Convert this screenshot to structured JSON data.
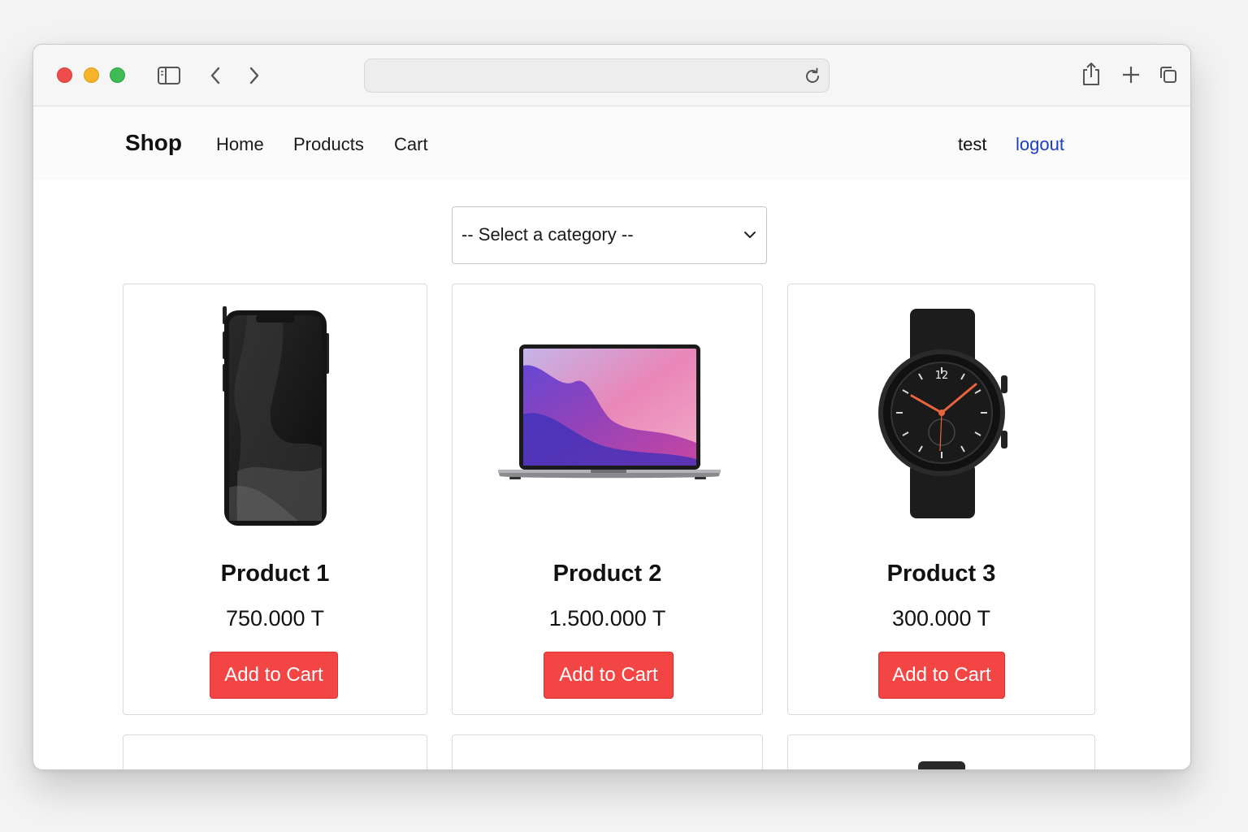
{
  "browser": {
    "url": "",
    "controls": [
      "sidebar-icon",
      "back-icon",
      "forward-icon",
      "reload-icon",
      "share-icon",
      "new-tab-icon",
      "tabs-overview-icon"
    ]
  },
  "navbar": {
    "brand": "Shop",
    "links": [
      {
        "label": "Home"
      },
      {
        "label": "Products"
      },
      {
        "label": "Cart"
      }
    ],
    "user": "test",
    "logout": "logout"
  },
  "filter": {
    "selected": "-- Select a category --"
  },
  "products": [
    {
      "name": "Product 1",
      "price": "750.000 T",
      "button": "Add to Cart",
      "image": "smartphone-image"
    },
    {
      "name": "Product 2",
      "price": "1.500.000 T",
      "button": "Add to Cart",
      "image": "laptop-image"
    },
    {
      "name": "Product 3",
      "price": "300.000 T",
      "button": "Add to Cart",
      "image": "smartwatch-image"
    }
  ],
  "colors": {
    "accent_button": "#f44545",
    "logout_link": "#1a3fc4",
    "watch_hands": "#e8643c"
  }
}
